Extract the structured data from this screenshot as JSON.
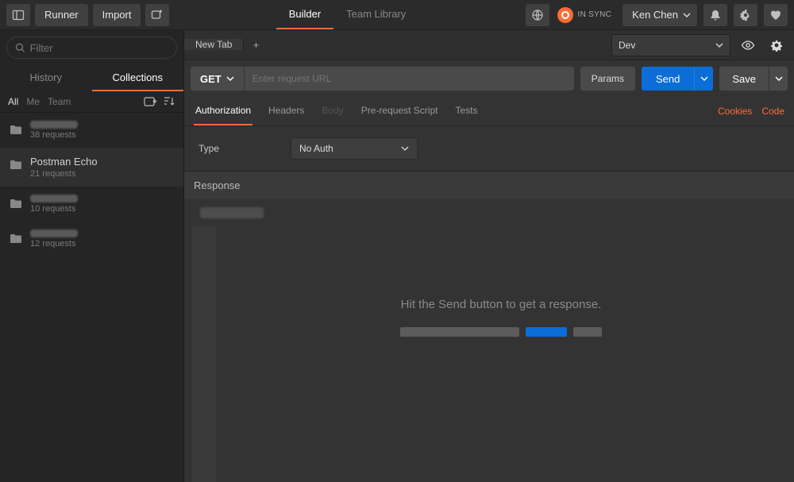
{
  "topbar": {
    "runner": "Runner",
    "import": "Import"
  },
  "center_tabs": {
    "builder": "Builder",
    "library": "Team Library"
  },
  "sync": {
    "label": "IN SYNC"
  },
  "user": {
    "name": "Ken Chen"
  },
  "filter": {
    "placeholder": "Filter"
  },
  "side_tabs": {
    "history": "History",
    "collections": "Collections"
  },
  "side_filters": {
    "all": "All",
    "me": "Me",
    "team": "Team"
  },
  "collections": [
    {
      "name": "",
      "meta": "38 requests"
    },
    {
      "name": "Postman Echo",
      "meta": "21 requests"
    },
    {
      "name": "",
      "meta": "10 requests"
    },
    {
      "name": "",
      "meta": "12 requests"
    }
  ],
  "ws_tab": "New Tab",
  "env": {
    "selected": "Dev"
  },
  "request": {
    "method": "GET",
    "url_placeholder": "Enter request URL",
    "params": "Params",
    "send": "Send",
    "save": "Save"
  },
  "req_tabs": {
    "auth": "Authorization",
    "headers": "Headers",
    "body": "Body",
    "prescript": "Pre-request Script",
    "tests": "Tests"
  },
  "links": {
    "cookies": "Cookies",
    "code": "Code"
  },
  "auth": {
    "type_label": "Type",
    "selected": "No Auth"
  },
  "response": {
    "header": "Response",
    "hint": "Hit the Send button to get a response."
  }
}
